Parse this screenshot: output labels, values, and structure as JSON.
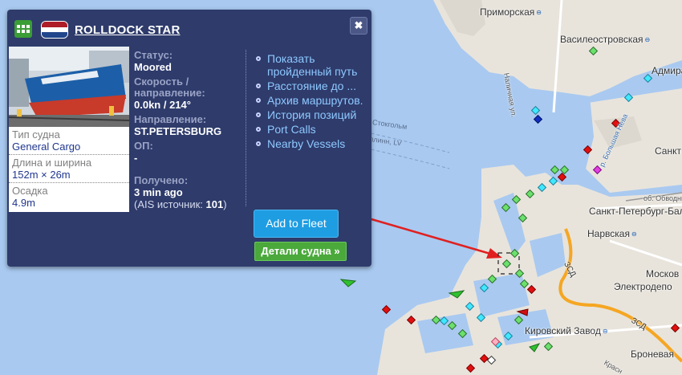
{
  "colors": {
    "water": "#a9c9f0",
    "land": "#e8e4dc",
    "popup_bg": "#2e3b6b",
    "link": "#8ec8ff",
    "add_fleet": "#1e9de2",
    "details_btn": "#4ba93c",
    "arrow": "#e02020",
    "orange_road": "#f5a623"
  },
  "popup": {
    "grid_icon": "grid-icon",
    "flag_icon": "netherlands-flag-icon",
    "vessel_name": "ROLLDOCK STAR",
    "close_icon": "✖",
    "specs": [
      {
        "label": "Тип судна",
        "value": "General Cargo"
      },
      {
        "label": "Длина и ширина",
        "value": "152m × 26m"
      },
      {
        "label": "Осадка",
        "value": "4.9m"
      }
    ],
    "status": {
      "status_label": "Статус:",
      "status_value": "Moored",
      "speed_label": "Скорость / направление:",
      "speed_value": "0.0kn / 214°",
      "dest_label": "Направление:",
      "dest_value": "ST.PETERSBURG",
      "eta_label": "ОП:",
      "eta_value": "-",
      "received_label": "Получено:",
      "received_value": "3 min ago",
      "source_prefix": "(AIS источник: ",
      "source_value": "101",
      "source_suffix": ")"
    },
    "links": [
      "Показать пройденный путь",
      "Расстояние до ...",
      "Архив маршрутов.",
      "История позиций",
      "Port Calls",
      "Nearby Vessels"
    ],
    "add_fleet": "Add to Fleet",
    "details": "Детали судна »"
  },
  "map": {
    "labels": {
      "primorskaya": "Приморская",
      "vasileostrovskaya": "Василеостровская",
      "admiral": "Адмира",
      "nalichnaya": "Наличная ул.",
      "stokgolm": "Стокгольм",
      "talinn": "Таллинн, LV",
      "sankt": "Санкт",
      "bolshaya_neva": "р. Большая Нева",
      "obvodny": "об. Обводный",
      "spb_balt": "Санкт-Петербург-Балт",
      "narvskaya": "Нарвская",
      "moskovs": "Москов",
      "zsd": "ЗСД",
      "zsd2": "ЗСД",
      "elektrodepo": "Электродепо",
      "kirovsky": "Кировский Завод",
      "broneva": "Броневая",
      "krasn": "Красн"
    }
  }
}
